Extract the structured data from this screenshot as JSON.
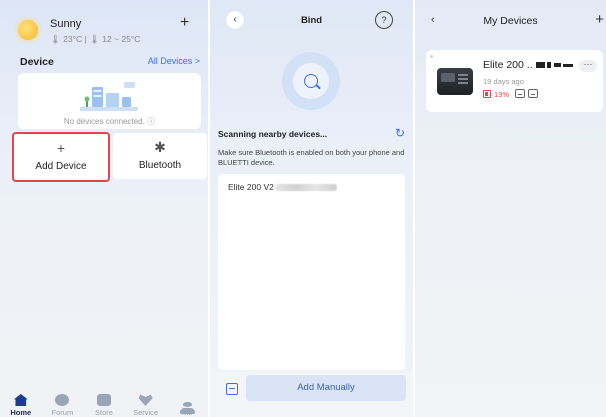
{
  "home": {
    "weather": {
      "condition": "Sunny",
      "detail": "🌡 23°C  |  🌡 12 ~ 25°C"
    },
    "add_icon": "plus-icon",
    "device_heading": "Device",
    "all_devices_link": "All Devices >",
    "empty_state": "No devices connected. ⓘ",
    "tiles": [
      {
        "icon": "+",
        "label": "Add Device",
        "highlighted": true
      },
      {
        "icon": "✱",
        "label": "Bluetooth"
      }
    ],
    "tabs": [
      {
        "label": "Home",
        "active": true
      },
      {
        "label": "Forum"
      },
      {
        "label": "Store"
      },
      {
        "label": "Service"
      },
      {
        "label": "Me"
      }
    ]
  },
  "bind": {
    "back": "‹",
    "title": "Bind",
    "help": "?",
    "scan_title": "Scanning nearby devices...",
    "refresh": "↻",
    "note": "Make sure Bluetooth is enabled on both your phone and BLUETTI device.",
    "found_devices": [
      {
        "name": "Elite 200 V2"
      }
    ],
    "add_manually": "Add Manually"
  },
  "my_devices": {
    "back": "‹",
    "title": "My Devices",
    "add": "+",
    "device": {
      "name": "Elite 200 ..",
      "last_seen": "19 days ago",
      "battery": "13%",
      "more": "···"
    }
  },
  "colors": {
    "accent": "#3b6ef5",
    "highlight_border": "#e2464b",
    "battery_low": "#e2464b"
  }
}
